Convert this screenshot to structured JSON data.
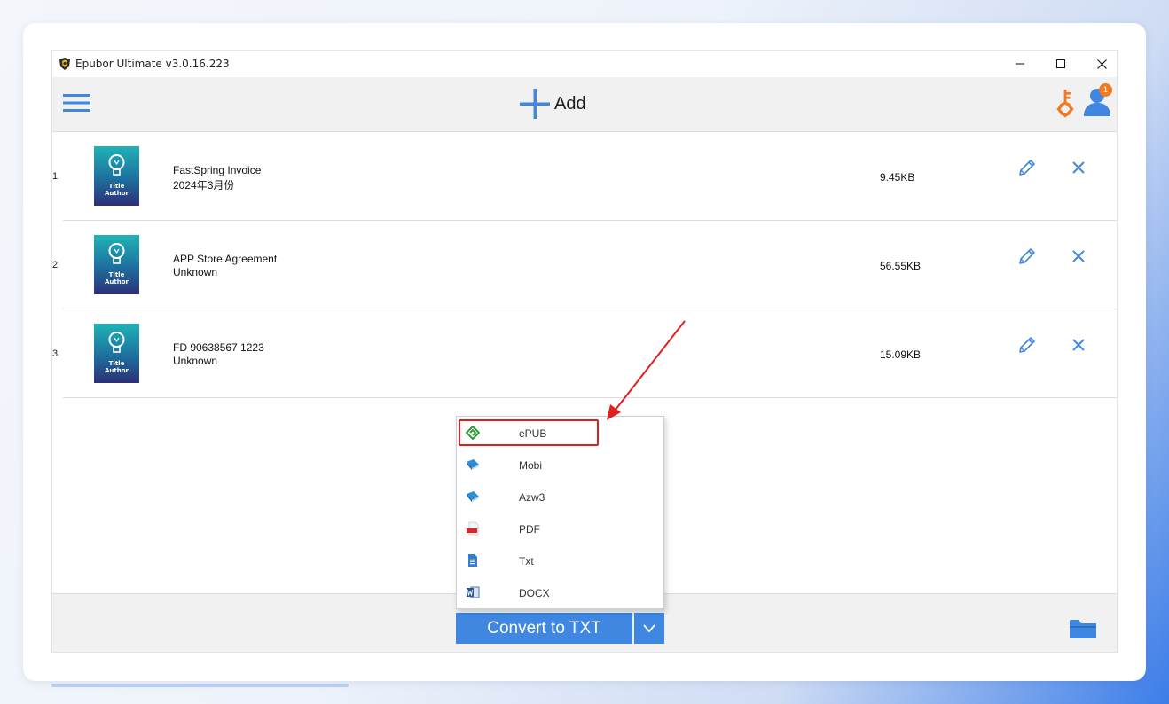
{
  "window": {
    "title": "Epubor Ultimate v3.0.16.223"
  },
  "toolbar": {
    "add_label": "Add",
    "notification_count": "1"
  },
  "books": [
    {
      "index": "1",
      "title": "FastSpring Invoice",
      "author": "2024年3月份",
      "size": "9.45KB",
      "cover_line1": "Title",
      "cover_line2": "Author"
    },
    {
      "index": "2",
      "title": "APP Store Agreement",
      "author": "Unknown",
      "size": "56.55KB",
      "cover_line1": "Title",
      "cover_line2": "Author"
    },
    {
      "index": "3",
      "title": "FD 90638567 1223",
      "author": "Unknown",
      "size": "15.09KB",
      "cover_line1": "Title",
      "cover_line2": "Author"
    }
  ],
  "format_menu": {
    "items": [
      {
        "label": "ePUB",
        "icon": "epub-icon",
        "highlighted": true
      },
      {
        "label": "Mobi",
        "icon": "mobi-book-icon"
      },
      {
        "label": "Azw3",
        "icon": "azw3-book-icon"
      },
      {
        "label": "PDF",
        "icon": "pdf-icon"
      },
      {
        "label": "Txt",
        "icon": "txt-document-icon"
      },
      {
        "label": "DOCX",
        "icon": "word-icon"
      }
    ]
  },
  "footer": {
    "convert_label": "Convert to TXT"
  },
  "colors": {
    "accent_blue": "#3f87e1",
    "highlight_red": "#e02020",
    "key_orange": "#f07a22"
  }
}
